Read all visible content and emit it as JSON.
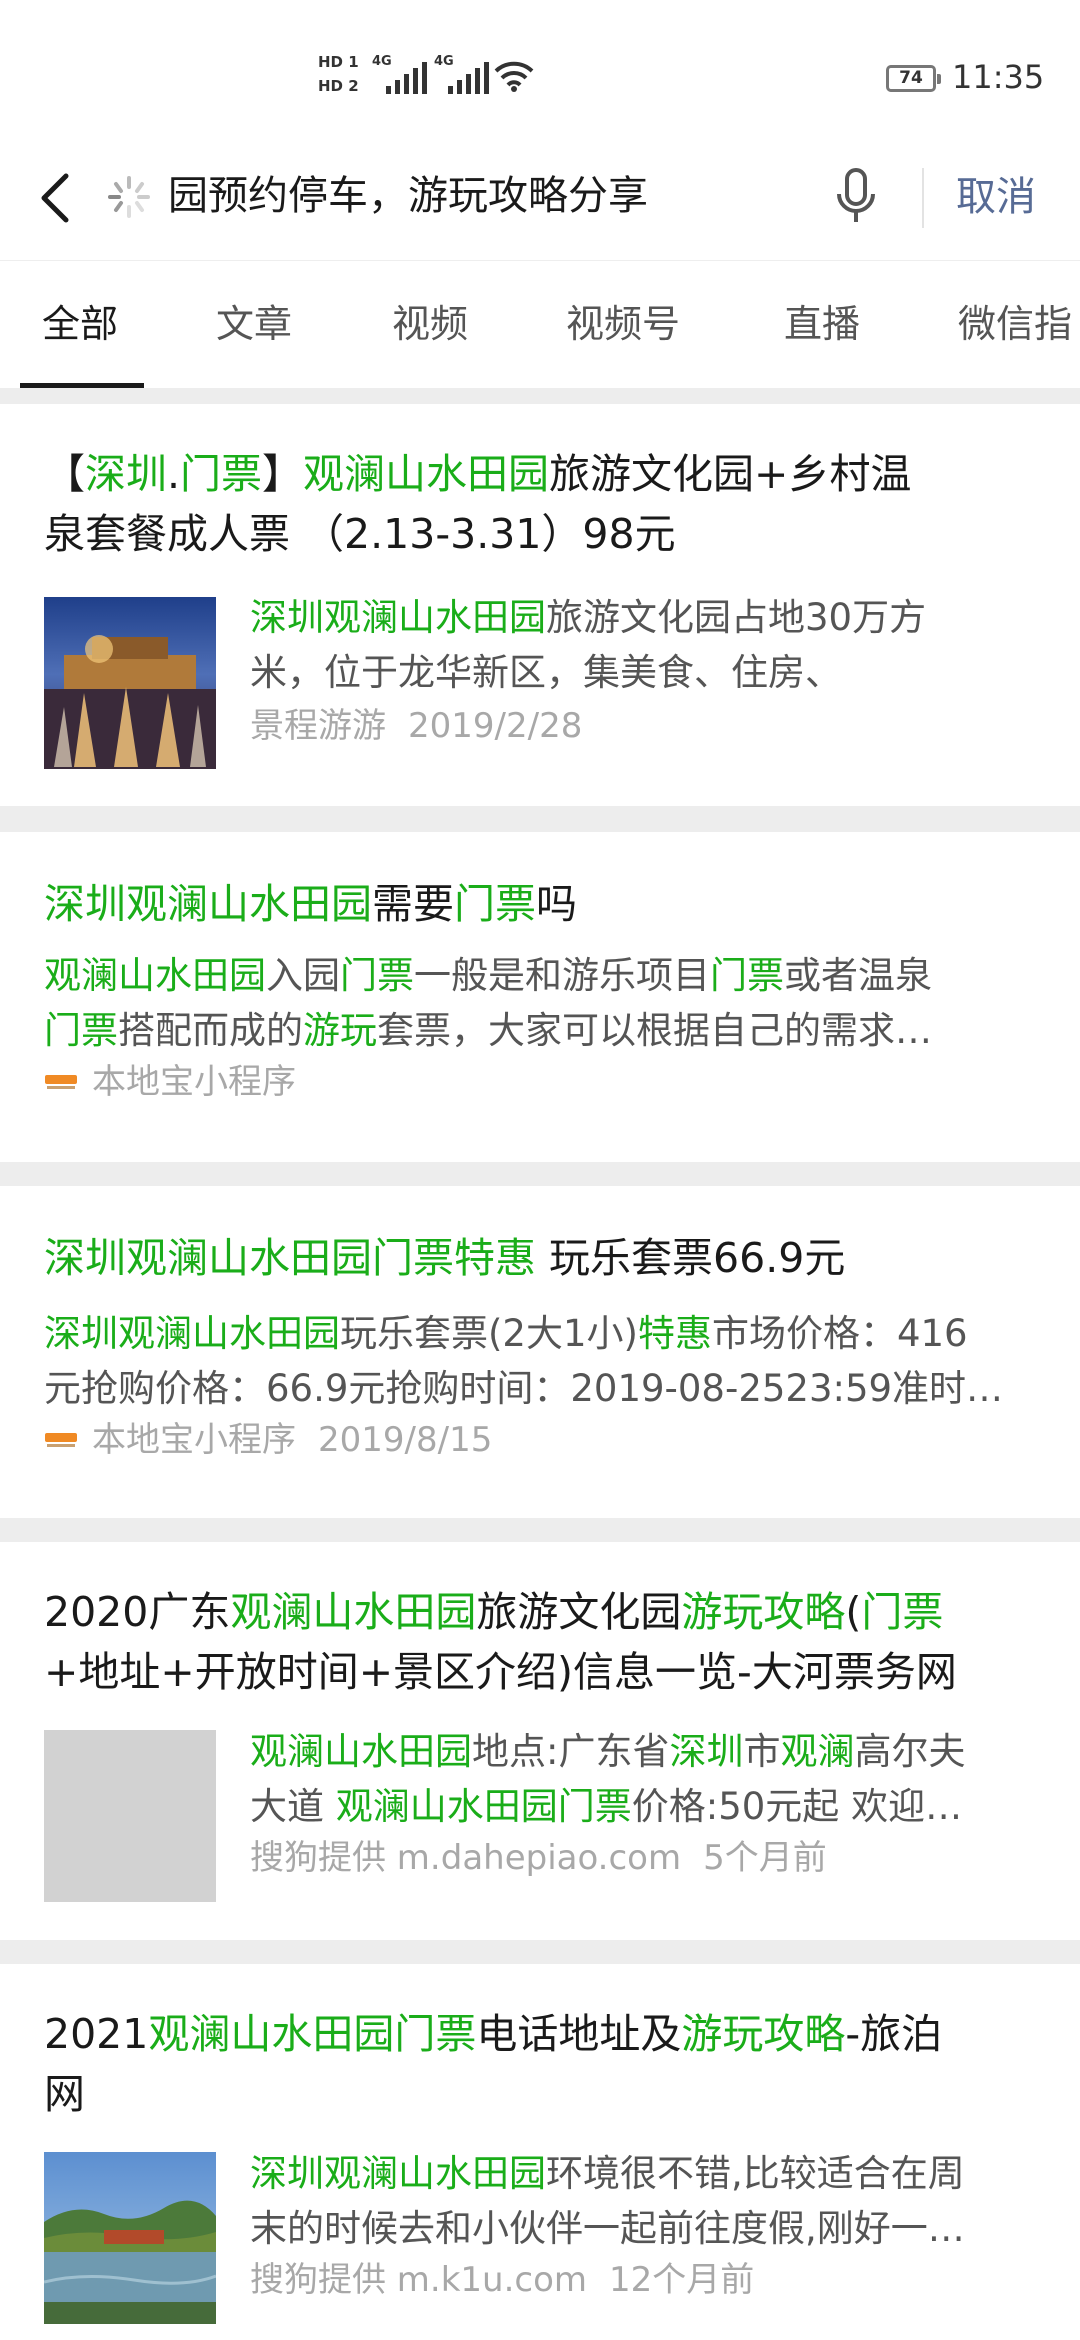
{
  "status_bar": {
    "hd1": "HD 1",
    "hd2": "HD 2",
    "net1": "4G",
    "net2": "4G",
    "battery": "74",
    "time": "11:35"
  },
  "search": {
    "query_visible": "园预约停车，游玩攻略分享",
    "cancel_label": "取消"
  },
  "tabs": [
    "全部",
    "文章",
    "视频",
    "视频号",
    "直播",
    "微信指"
  ],
  "active_tab": "全部",
  "colors": {
    "highlight": "#1aad19",
    "link_blue": "#576b95",
    "meta_gray": "#a8a8a8"
  },
  "results": [
    {
      "title_segments": [
        {
          "t": "【",
          "hl": false
        },
        {
          "t": "深圳",
          "hl": true
        },
        {
          "t": ".",
          "hl": false
        },
        {
          "t": "门票",
          "hl": true
        },
        {
          "t": "】",
          "hl": false
        },
        {
          "t": "观澜山水田园",
          "hl": true
        },
        {
          "t": "旅游文化园+乡村温",
          "hl": false
        }
      ],
      "title_line2": "泉套餐成人票 （2.13-3.31）98元",
      "desc_line1_segments": [
        {
          "t": "深圳观澜山水田园",
          "hl": true
        },
        {
          "t": "旅游文化园占地30万方",
          "hl": false
        }
      ],
      "desc_line2": "米，位于龙华新区，集美食、住房、",
      "source": "景程游游",
      "date": "2019/2/28",
      "thumb": "fountain-night-photo"
    },
    {
      "title_segments": [
        {
          "t": "深圳观澜山水田园",
          "hl": true
        },
        {
          "t": "需要",
          "hl": false
        },
        {
          "t": "门票",
          "hl": true
        },
        {
          "t": "吗",
          "hl": false
        }
      ],
      "desc_line1_segments": [
        {
          "t": "观澜山水田园",
          "hl": true
        },
        {
          "t": "入园",
          "hl": false
        },
        {
          "t": "门票",
          "hl": true
        },
        {
          "t": "一般是和游乐项目",
          "hl": false
        },
        {
          "t": "门票",
          "hl": true
        },
        {
          "t": "或者温泉",
          "hl": false
        }
      ],
      "desc_line2_segments": [
        {
          "t": "门票",
          "hl": true
        },
        {
          "t": "搭配而成的",
          "hl": false
        },
        {
          "t": "游玩",
          "hl": true
        },
        {
          "t": "套票，大家可以根据自己的需求…",
          "hl": false
        }
      ],
      "source": "本地宝小程序",
      "date": ""
    },
    {
      "title_segments": [
        {
          "t": "深圳观澜山水田园门票特惠",
          "hl": true
        },
        {
          "t": " 玩乐套票66.9元",
          "hl": false
        }
      ],
      "desc_line1_segments": [
        {
          "t": "深圳观澜山水田园",
          "hl": true
        },
        {
          "t": "玩乐套票(2大1小)",
          "hl": false
        },
        {
          "t": "特惠",
          "hl": true
        },
        {
          "t": "市场价格：416",
          "hl": false
        }
      ],
      "desc_line2": "元抢购价格：66.9元抢购时间：2019-08-2523:59准时…",
      "source": "本地宝小程序",
      "date": "2019/8/15"
    },
    {
      "title_segments": [
        {
          "t": "2020广东",
          "hl": false
        },
        {
          "t": "观澜山水田园",
          "hl": true
        },
        {
          "t": "旅游文化园",
          "hl": false
        },
        {
          "t": "游玩攻略",
          "hl": true
        },
        {
          "t": "(",
          "hl": false
        },
        {
          "t": "门票",
          "hl": true
        }
      ],
      "title_line2": "+地址+开放时间+景区介绍)信息一览-大河票务网",
      "desc_line1_segments": [
        {
          "t": "观澜山水田园",
          "hl": true
        },
        {
          "t": "地点:广东省",
          "hl": false
        },
        {
          "t": "深圳",
          "hl": true
        },
        {
          "t": "市",
          "hl": false
        },
        {
          "t": "观澜",
          "hl": true
        },
        {
          "t": "高尔夫",
          "hl": false
        }
      ],
      "desc_line2_segments": [
        {
          "t": "大道 ",
          "hl": false
        },
        {
          "t": "观澜山水田园门票",
          "hl": true
        },
        {
          "t": "价格:50元起 欢迎…",
          "hl": false
        }
      ],
      "source": "搜狗提供 m.dahepiao.com",
      "date": "5个月前",
      "thumb": "gray-placeholder"
    },
    {
      "title_segments": [
        {
          "t": "2021",
          "hl": false
        },
        {
          "t": "观澜山水田园门票",
          "hl": true
        },
        {
          "t": "电话地址及",
          "hl": false
        },
        {
          "t": "游玩攻略",
          "hl": true
        },
        {
          "t": "-旅泊",
          "hl": false
        }
      ],
      "title_line2": "网",
      "desc_line1_segments": [
        {
          "t": "深圳观澜山水田园",
          "hl": true
        },
        {
          "t": "环境很不错,比较适合在周",
          "hl": false
        }
      ],
      "desc_line2": "末的时候去和小伙伴一起前往度假,刚好一…",
      "source": "搜狗提供 m.k1u.com",
      "date": "12个月前",
      "thumb": "lake-landscape-photo"
    }
  ]
}
